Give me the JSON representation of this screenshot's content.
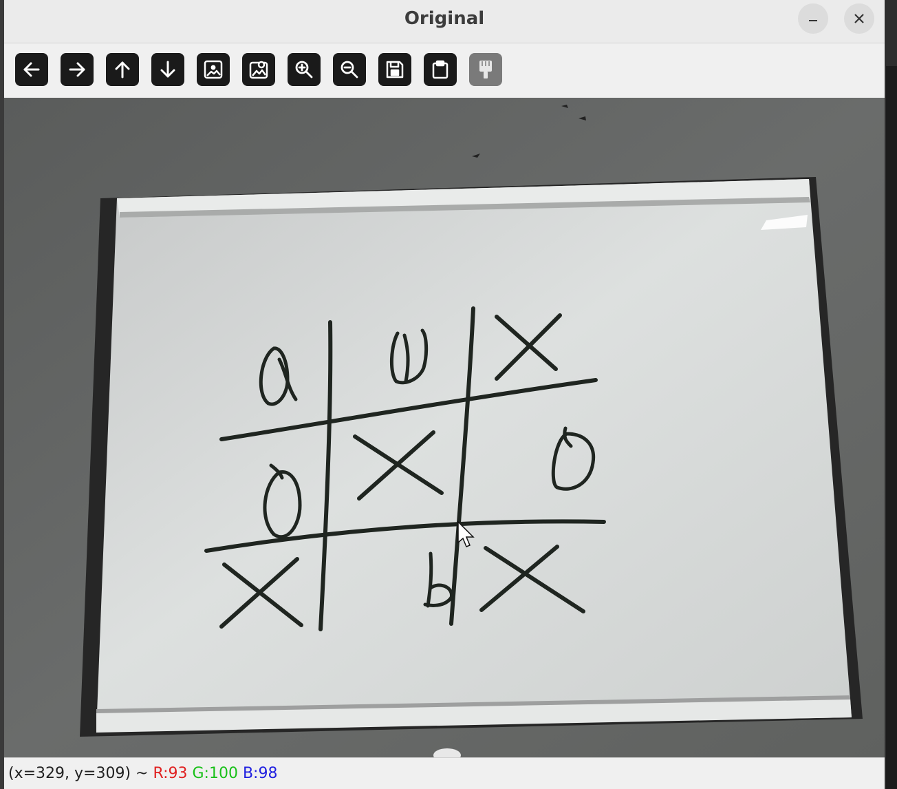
{
  "window": {
    "title": "Original",
    "minimize_icon": "minimize-icon",
    "close_icon": "close-icon"
  },
  "toolbar": {
    "buttons": [
      {
        "icon": "arrow-left-icon"
      },
      {
        "icon": "arrow-right-icon"
      },
      {
        "icon": "arrow-up-icon"
      },
      {
        "icon": "arrow-down-icon"
      },
      {
        "icon": "image-icon"
      },
      {
        "icon": "image-properties-icon"
      },
      {
        "icon": "zoom-in-icon"
      },
      {
        "icon": "zoom-out-icon"
      },
      {
        "icon": "save-icon"
      },
      {
        "icon": "clipboard-icon"
      },
      {
        "icon": "paint-brush-icon",
        "disabled": true
      }
    ]
  },
  "image": {
    "content": "tic-tac-toe drawn on whiteboard",
    "board": [
      [
        "O",
        "O",
        "X"
      ],
      [
        "O",
        "X",
        "O"
      ],
      [
        "X",
        "O",
        "X"
      ]
    ]
  },
  "status": {
    "coords": "(x=329, y=309) ~",
    "r": "R:93",
    "g": "G:100",
    "b": "B:98"
  },
  "colors": {
    "r": "#e02020",
    "g": "#18c018",
    "b": "#2020e0"
  }
}
